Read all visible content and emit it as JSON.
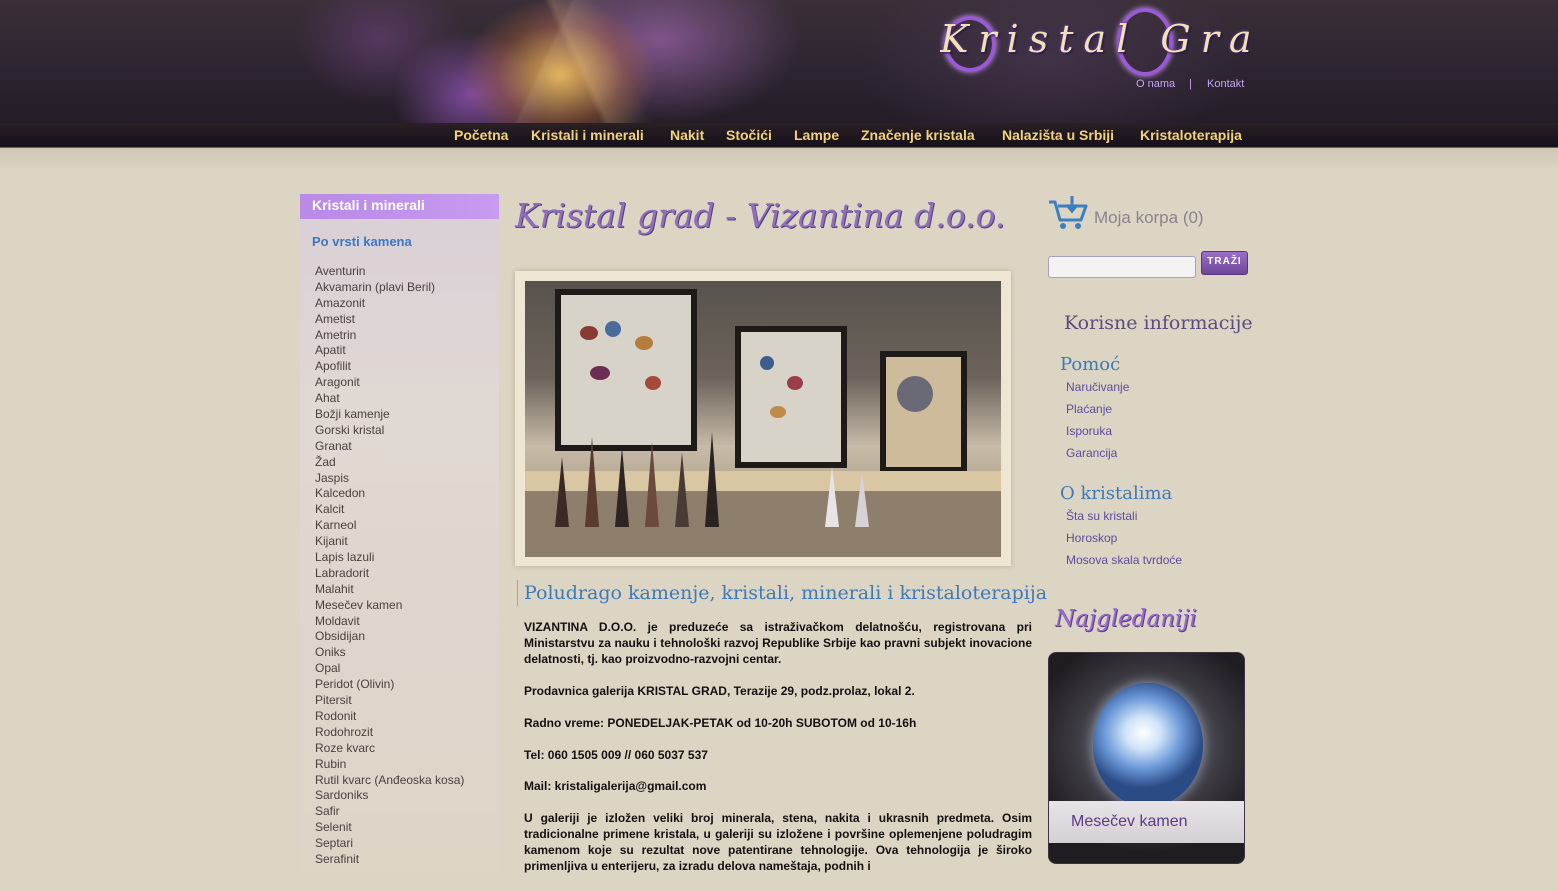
{
  "header": {
    "logo_text": "Kristal Grad",
    "top_links": [
      "O nama",
      "|",
      "Kontakt"
    ]
  },
  "nav": {
    "items": [
      "Početna",
      "Kristali i minerali",
      "Nakit",
      "Stočići",
      "Lampe",
      "Značenje kristala",
      "Nalazišta u Srbiji",
      "Kristaloterapija"
    ]
  },
  "sidebar": {
    "title": "Kristali i minerali",
    "subtitle": "Po vrsti kamena",
    "items": [
      "Aventurin",
      "Akvamarin (plavi Beril)",
      "Amazonit",
      "Ametist",
      "Ametrin",
      "Apatit",
      "Apofilit",
      "Aragonit",
      "Ahat",
      "Božji kamenje",
      "Gorski kristal",
      "Granat",
      "Žad",
      "Jaspis",
      "Kalcedon",
      "Kalcit",
      "Karneol",
      "Kijanit",
      "Lapis lazuli",
      "Labradorit",
      "Malahit",
      "Mesečev kamen",
      "Moldavit",
      "Obsidijan",
      "Oniks",
      "Opal",
      "Peridot (Olivin)",
      "Pitersit",
      "Rodonit",
      "Rodohrozit",
      "Roze kvarc",
      "Rubin",
      "Rutil kvarc (Anđeoska kosa)",
      "Sardoniks",
      "Safir",
      "Selenit",
      "Septari",
      "Serafinit"
    ]
  },
  "main": {
    "heading": "Kristal grad - Vizantina d.o.o.",
    "content_title": "Poludrago kamenje, kristali, minerali i kristaloterapija",
    "paragraphs": [
      "VIZANTINA D.O.O. je preduzeće sa istraživačkom delatnošću, registrovana pri Ministarstvu za nauku i tehnološki razvoj Republike Srbije kao pravni subjekt inovacione delatnosti, tj. kao proizvodno-razvojni centar.",
      "Prodavnica galerija KRISTAL GRAD, Terazije 29, podz.prolaz, lokal 2.",
      "Radno vreme: PONEDELJAK-PETAK od 10-20h SUBOTOM od 10-16h",
      "Tel: 060 1505 009 // 060 5037 537",
      "Mail: kristaligalerija@gmail.com",
      "U galeriji je izložen veliki broj minerala, stena, nakita i ukrasnih predmeta. Osim tradicionalne primene kristala, u galeriji su izložene i površine oplemenjene poludragim kamenom koje su rezultat nove patentirane tehnologije. Ova tehnologija je široko primenljiva u enterijeru, za izradu delova nameštaja, podnih i"
    ]
  },
  "right": {
    "cart_label": "Moja korpa (0)",
    "search": {
      "value": "",
      "button_label": "TRAŽI"
    },
    "info_title": "Korisne informacije",
    "help": {
      "title": "Pomoć",
      "links": [
        "Naručivanje",
        "Plaćanje",
        "Isporuka",
        "Garancija"
      ]
    },
    "about": {
      "title": "O kristalima",
      "links": [
        "Šta su kristali",
        "Horoskop",
        "Mosova skala tvrdoće"
      ]
    },
    "most_viewed": {
      "title": "Najgledaniji",
      "item": "Mesečev kamen"
    }
  },
  "colors": {
    "nav_text": "#f2d27a",
    "sidebar_title_bg": "#b98ae6",
    "link_blue": "#3e79b8",
    "accent_purple": "#9a6bd0"
  }
}
